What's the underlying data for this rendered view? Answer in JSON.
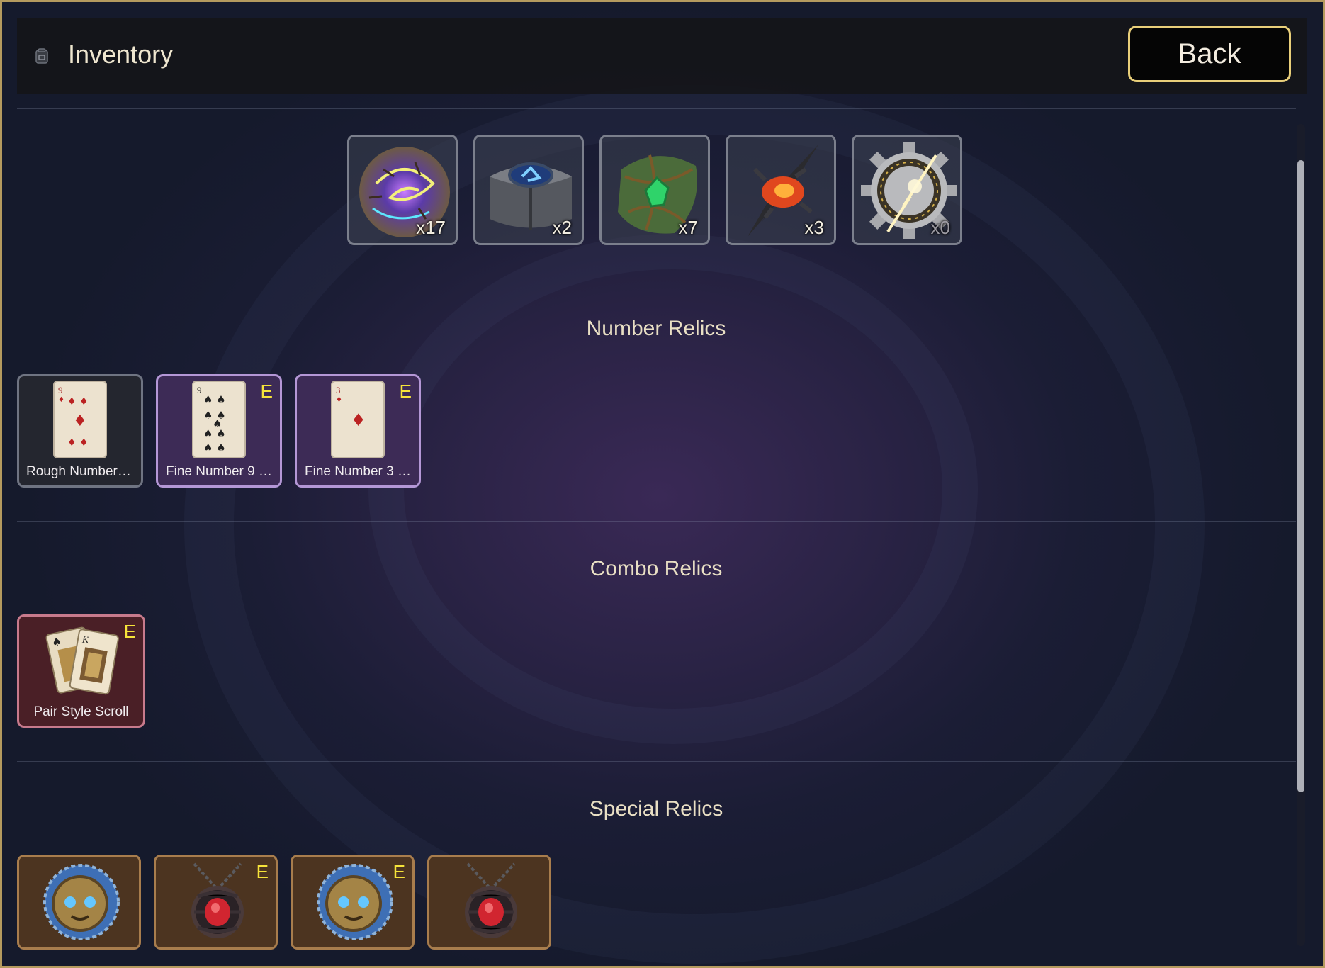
{
  "header": {
    "title": "Inventory",
    "back_label": "Back"
  },
  "resources": [
    {
      "icon": "cracked-vortex-orb-icon",
      "count": "x17"
    },
    {
      "icon": "blue-rune-stone-icon",
      "count": "x2"
    },
    {
      "icon": "green-vine-emerald-icon",
      "count": "x7"
    },
    {
      "icon": "lava-crystal-icon",
      "count": "x3"
    },
    {
      "icon": "rune-gear-icon",
      "count": "x0"
    }
  ],
  "sections": {
    "number_relics": {
      "title": "Number Relics",
      "items": [
        {
          "name": "Rough Number …",
          "equipped": ""
        },
        {
          "name": "Fine Number 9 …",
          "equipped": "E"
        },
        {
          "name": "Fine Number 3 …",
          "equipped": "E"
        }
      ]
    },
    "combo_relics": {
      "title": "Combo Relics",
      "items": [
        {
          "name": "Pair Style Scroll",
          "equipped": "E"
        }
      ]
    },
    "special_relics": {
      "title": "Special Relics",
      "items": [
        {
          "icon": "blue-shield-face-icon",
          "equipped": ""
        },
        {
          "icon": "red-gem-amulet-icon",
          "equipped": "E"
        },
        {
          "icon": "blue-shield-face-icon",
          "equipped": "E"
        },
        {
          "icon": "red-gem-amulet-icon",
          "equipped": ""
        }
      ]
    }
  },
  "colors": {
    "frame_border": "#b49a5e",
    "back_border": "#e9cf7a",
    "equip_marker": "#f6e33a",
    "section_title": "#e9dfc4"
  }
}
